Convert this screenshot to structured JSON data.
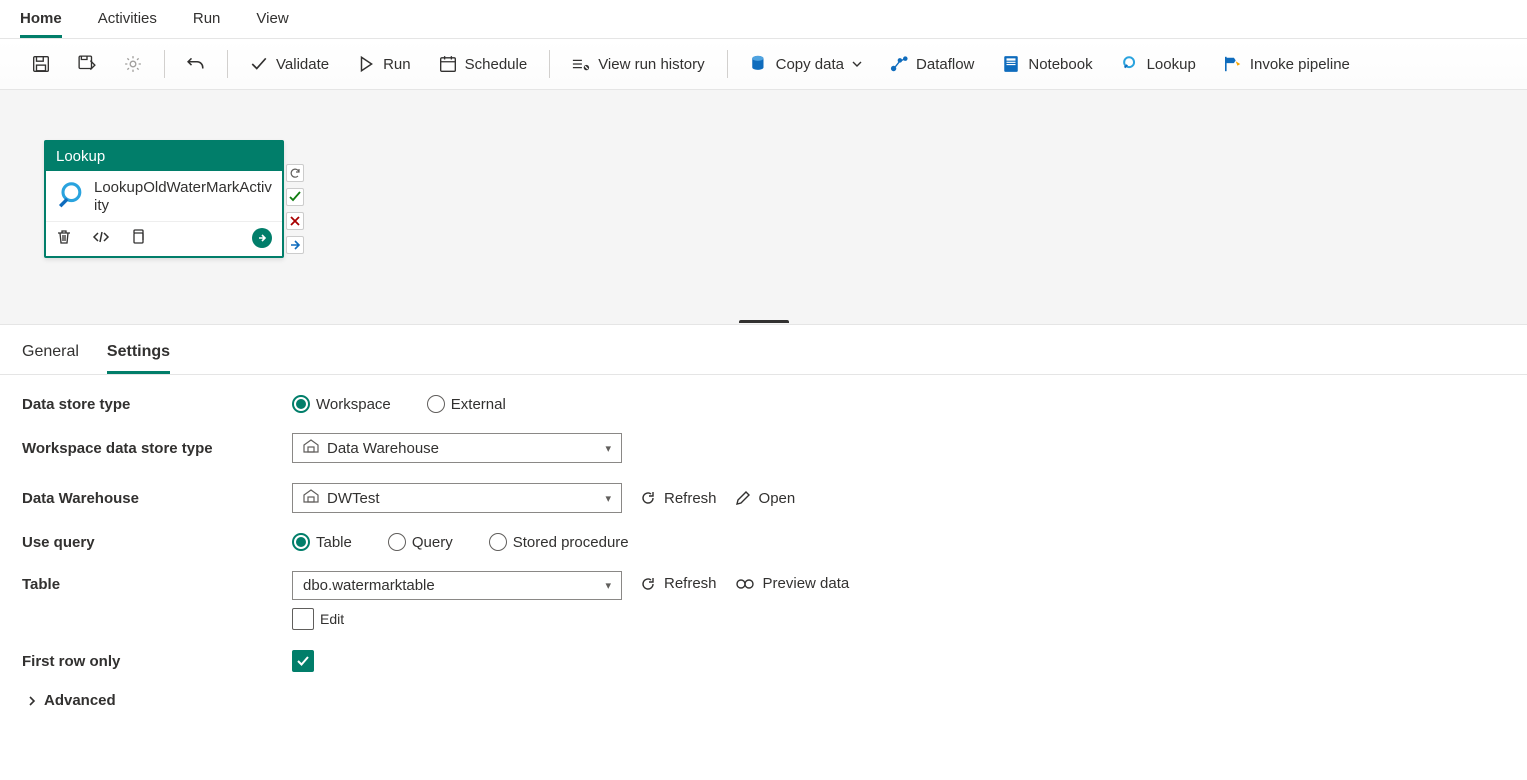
{
  "tabs": {
    "home": "Home",
    "activities": "Activities",
    "run": "Run",
    "view": "View"
  },
  "toolbar": {
    "validate": "Validate",
    "run": "Run",
    "schedule": "Schedule",
    "view_run_history": "View run history",
    "copy_data": "Copy data",
    "dataflow": "Dataflow",
    "notebook": "Notebook",
    "lookup": "Lookup",
    "invoke_pipeline": "Invoke pipeline"
  },
  "activity": {
    "type": "Lookup",
    "name": "LookupOldWaterMarkActivity"
  },
  "detail_tabs": {
    "general": "General",
    "settings": "Settings"
  },
  "form": {
    "data_store_type": {
      "label": "Data store type",
      "workspace": "Workspace",
      "external": "External"
    },
    "ws_data_store_type": {
      "label": "Workspace data store type",
      "value": "Data Warehouse"
    },
    "data_warehouse": {
      "label": "Data Warehouse",
      "value": "DWTest",
      "refresh": "Refresh",
      "open": "Open"
    },
    "use_query": {
      "label": "Use query",
      "table": "Table",
      "query": "Query",
      "sp": "Stored procedure"
    },
    "table": {
      "label": "Table",
      "value": "dbo.watermarktable",
      "refresh": "Refresh",
      "preview": "Preview data",
      "edit": "Edit"
    },
    "first_row": {
      "label": "First row only"
    },
    "advanced": "Advanced"
  }
}
